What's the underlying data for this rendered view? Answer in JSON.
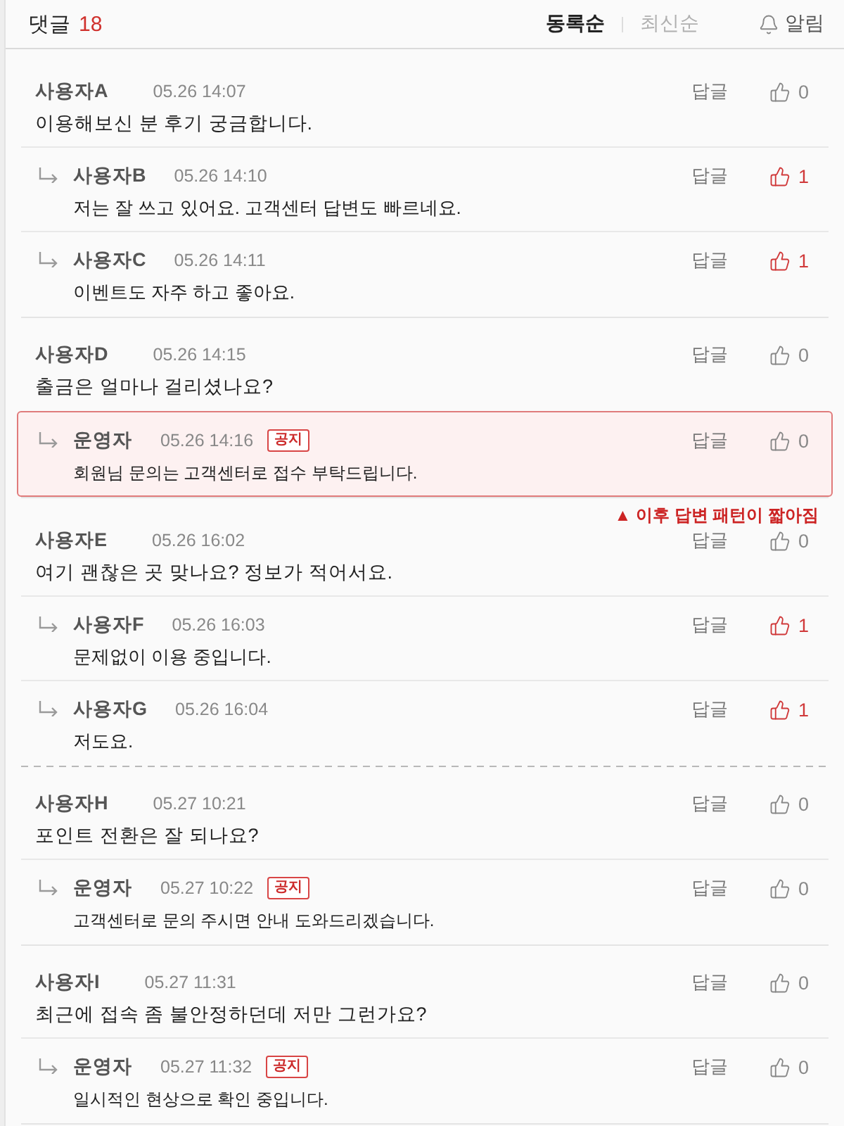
{
  "header": {
    "title": "댓글",
    "count": "18",
    "sort_options": [
      {
        "label": "동록순",
        "selected": true
      },
      {
        "label": "최신순",
        "selected": false
      }
    ],
    "notify_label": "알림"
  },
  "threads": [
    {
      "dashed_divider": false,
      "comment": {
        "author": "사용자A",
        "time": "05.26 14:07",
        "text": "이용해보신 분 후기 궁금합니다.",
        "reply_label": "답글",
        "likes": "0",
        "liked": false
      },
      "replies": [
        {
          "kind": "user",
          "author": "사용자B",
          "time": "05.26 14:10",
          "text": "저는 잘 쓰고 있어요. 고객센터 답변도 빠르네요.",
          "reply_label": "답글",
          "likes": "1",
          "liked": true,
          "highlighted": false
        },
        {
          "kind": "user",
          "author": "사용자C",
          "time": "05.26 14:11",
          "text": "이벤트도 자주 하고 좋아요.",
          "reply_label": "답글",
          "likes": "1",
          "liked": true,
          "highlighted": false
        }
      ]
    },
    {
      "dashed_divider": false,
      "comment": {
        "author": "사용자D",
        "time": "05.26 14:15",
        "text": "출금은 얼마나 걸리셨나요?",
        "reply_label": "답글",
        "likes": "0",
        "liked": false
      },
      "replies": [
        {
          "kind": "operator",
          "author": "운영자",
          "time": "05.26 14:16",
          "badge": "공지",
          "text": "회원님 문의는 고객센터로 접수 부탁드립니다.",
          "reply_label": "답글",
          "likes": "0",
          "liked": false,
          "highlighted": true
        }
      ],
      "note": "▲ 이후 답변 패턴이 짧아짐"
    },
    {
      "dashed_divider": true,
      "comment": {
        "author": "사용자E",
        "time": "05.26 16:02",
        "text": "여기 괜찮은 곳 맞나요? 정보가 적어서요.",
        "reply_label": "답글",
        "likes": "0",
        "liked": false
      },
      "replies": [
        {
          "kind": "user",
          "author": "사용자F",
          "time": "05.26 16:03",
          "text": "문제없이 이용 중입니다.",
          "reply_label": "답글",
          "likes": "1",
          "liked": true,
          "highlighted": false
        },
        {
          "kind": "user",
          "author": "사용자G",
          "time": "05.26 16:04",
          "text": "저도요.",
          "reply_label": "답글",
          "likes": "1",
          "liked": true,
          "highlighted": false
        }
      ]
    },
    {
      "dashed_divider": false,
      "comment": {
        "author": "사용자H",
        "time": "05.27 10:21",
        "text": "포인트 전환은 잘 되나요?",
        "reply_label": "답글",
        "likes": "0",
        "liked": false
      },
      "replies": [
        {
          "kind": "operator",
          "author": "운영자",
          "time": "05.27 10:22",
          "badge": "공지",
          "text": "고객센터로 문의 주시면 안내 도와드리겠습니다.",
          "reply_label": "답글",
          "likes": "0",
          "liked": false,
          "highlighted": false
        }
      ]
    },
    {
      "dashed_divider": false,
      "comment": {
        "author": "사용자I",
        "time": "05.27 11:31",
        "text": "최근에 접속 좀 불안정하던데 저만 그런가요?",
        "reply_label": "답글",
        "likes": "0",
        "liked": false
      },
      "replies": [
        {
          "kind": "operator",
          "author": "운영자",
          "time": "05.27 11:32",
          "badge": "공지",
          "text": "일시적인 현상으로 확인 중입니다.",
          "reply_label": "답글",
          "likes": "0",
          "liked": false,
          "highlighted": false
        }
      ]
    }
  ]
}
